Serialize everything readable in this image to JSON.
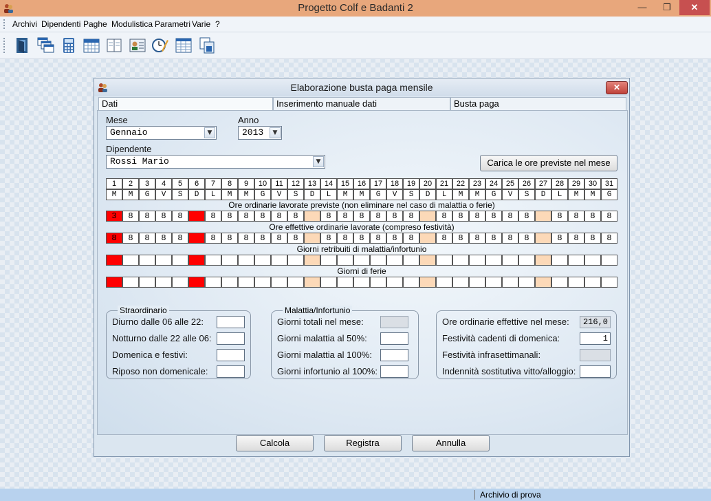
{
  "app": {
    "title": "Progetto Colf e Badanti 2",
    "status_text": "Archivio di prova"
  },
  "window_controls": {
    "minimize": "—",
    "maximize": "❐",
    "close": "✕"
  },
  "menu": [
    "Archivi",
    "Dipendenti",
    "Paghe",
    "Modulistica",
    "Parametri",
    "Varie",
    "?"
  ],
  "toolbar": [
    "exit-door-icon",
    "windows-cascade-icon",
    "calculator-icon",
    "calendar-icon",
    "address-book-icon",
    "employee-card-icon",
    "clock-edit-icon",
    "spreadsheet-icon",
    "copy-documents-icon"
  ],
  "dialog": {
    "title": "Elaborazione busta paga mensile",
    "close": "✕",
    "tabs": [
      "Dati",
      "Inserimento manuale dati",
      "Busta paga"
    ],
    "mese_label": "Mese",
    "mese_value": "Gennaio",
    "anno_label": "Anno",
    "anno_value": "2013",
    "dipendente_label": "Dipendente",
    "dipendente_value": "Rossi Mario",
    "carica_button": "Carica le ore previste nel mese",
    "days": [
      "1",
      "2",
      "3",
      "4",
      "5",
      "6",
      "7",
      "8",
      "9",
      "10",
      "11",
      "12",
      "13",
      "14",
      "15",
      "16",
      "17",
      "18",
      "19",
      "20",
      "21",
      "22",
      "23",
      "24",
      "25",
      "26",
      "27",
      "28",
      "29",
      "30",
      "31"
    ],
    "weekdays": [
      "M",
      "M",
      "G",
      "V",
      "S",
      "D",
      "L",
      "M",
      "M",
      "G",
      "V",
      "S",
      "D",
      "L",
      "M",
      "M",
      "G",
      "V",
      "S",
      "D",
      "L",
      "M",
      "M",
      "G",
      "V",
      "S",
      "D",
      "L",
      "M",
      "M",
      "G"
    ],
    "rows": [
      {
        "label": "Ore ordinarie lavorate previste (non eliminare nel caso di malattia o ferie)",
        "values": [
          "3",
          "8",
          "8",
          "8",
          "8",
          "",
          "8",
          "8",
          "8",
          "8",
          "8",
          "8",
          "",
          "8",
          "8",
          "8",
          "8",
          "8",
          "8",
          "",
          "8",
          "8",
          "8",
          "8",
          "8",
          "8",
          "",
          "8",
          "8",
          "8",
          "8"
        ]
      },
      {
        "label": "Ore effettive ordinarie lavorate (compreso festività)",
        "values": [
          "8",
          "8",
          "8",
          "8",
          "8",
          "",
          "8",
          "8",
          "8",
          "8",
          "8",
          "8",
          "",
          "8",
          "8",
          "8",
          "8",
          "8",
          "8",
          "",
          "8",
          "8",
          "8",
          "8",
          "8",
          "8",
          "",
          "8",
          "8",
          "8",
          "8"
        ]
      },
      {
        "label": "Giorni retribuiti di malattia/infortunio",
        "values": [
          "",
          "",
          "",
          "",
          "",
          "",
          "",
          "",
          "",
          "",
          "",
          "",
          "",
          "",
          "",
          "",
          "",
          "",
          "",
          "",
          "",
          "",
          "",
          "",
          "",
          "",
          "",
          "",
          "",
          "",
          ""
        ]
      },
      {
        "label": "Giorni di ferie",
        "values": [
          "",
          "",
          "",
          "",
          "",
          "",
          "",
          "",
          "",
          "",
          "",
          "",
          "",
          "",
          "",
          "",
          "",
          "",
          "",
          "",
          "",
          "",
          "",
          "",
          "",
          "",
          "",
          "",
          "",
          "",
          ""
        ]
      }
    ],
    "cell_styles": [
      "red",
      "white",
      "white",
      "white",
      "white",
      "red",
      "white",
      "white",
      "white",
      "white",
      "white",
      "white",
      "sat",
      "white",
      "white",
      "white",
      "white",
      "white",
      "white",
      "sat",
      "white",
      "white",
      "white",
      "white",
      "white",
      "white",
      "sat",
      "white",
      "white",
      "white",
      "white"
    ],
    "straordinario": {
      "title": "Straordinario",
      "fields": [
        {
          "label": "Diurno dalle 06 alle 22:",
          "value": ""
        },
        {
          "label": "Notturno dalle 22 alle 06:",
          "value": ""
        },
        {
          "label": "Domenica e festivi:",
          "value": ""
        },
        {
          "label": "Riposo non domenicale:",
          "value": ""
        }
      ]
    },
    "malattia": {
      "title": "Malattia/Infortunio",
      "fields": [
        {
          "label": "Giorni totali nel mese:",
          "value": ""
        },
        {
          "label": "Giorni malattia al 50%:",
          "value": ""
        },
        {
          "label": "Giorni malattia al 100%:",
          "value": ""
        },
        {
          "label": "Giorni infortunio al 100%:",
          "value": ""
        }
      ]
    },
    "riepilogo": {
      "fields": [
        {
          "label": "Ore ordinarie effettive nel mese:",
          "value": "216,0"
        },
        {
          "label": "Festività cadenti di domenica:",
          "value": "1"
        },
        {
          "label": "Festività infrasettimanali:",
          "value": ""
        },
        {
          "label": "Indennità sostitutiva vitto/alloggio:",
          "value": ""
        }
      ]
    },
    "buttons": {
      "calcola": "Calcola",
      "registra": "Registra",
      "annulla": "Annulla"
    }
  }
}
